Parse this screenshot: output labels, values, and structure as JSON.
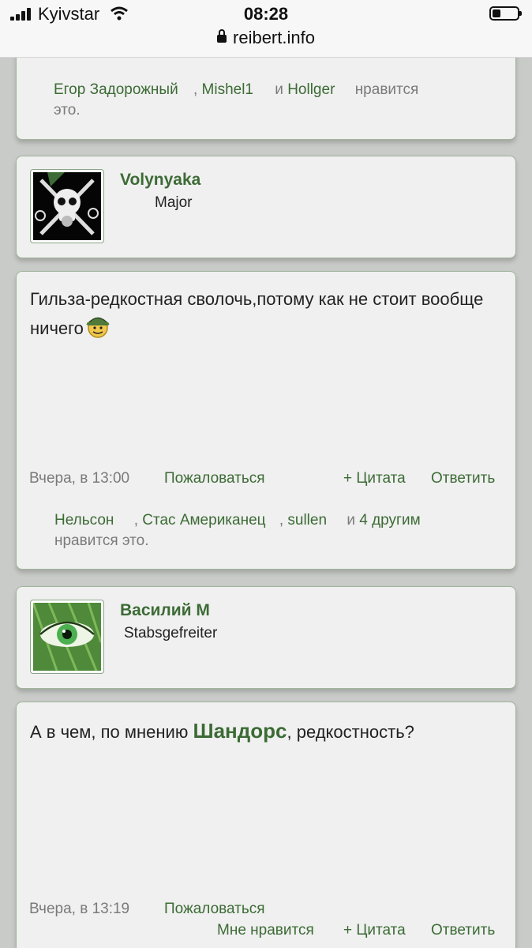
{
  "status": {
    "carrier": "Kyivstar",
    "time": "08:28",
    "url": "reibert.info"
  },
  "top_likes": {
    "name1": "Егор Задорожный",
    "sep1": ",",
    "name2": "Mishel1",
    "and": "и",
    "name3": "Hollger",
    "suffix1": "нравится",
    "suffix2": "это."
  },
  "post1": {
    "author": "Volynyaka",
    "rank": "Major",
    "text": "Гильза-редкостная сволочь,потому как не стоит вообще ничего",
    "time": "Вчера, в 13:00",
    "report": "Пожаловаться",
    "quote": "+ Цитата",
    "reply": "Ответить",
    "likes": {
      "name1": "Нельсон",
      "sep1": ",",
      "name2": "Стас Американец",
      "sep2": ",",
      "name3": "sullen",
      "and": "и",
      "others": "4 другим",
      "suffix": "нравится это."
    }
  },
  "post2": {
    "author": "Василий М",
    "rank": "Stabsgefreiter",
    "text_before": "А в чем, по мнению ",
    "mention": "Шандорс",
    "text_after": ", редкостность?",
    "time": "Вчера, в 13:19",
    "report": "Пожаловаться",
    "like": "Мне нравится",
    "quote": "+ Цитата",
    "reply": "Ответить"
  }
}
